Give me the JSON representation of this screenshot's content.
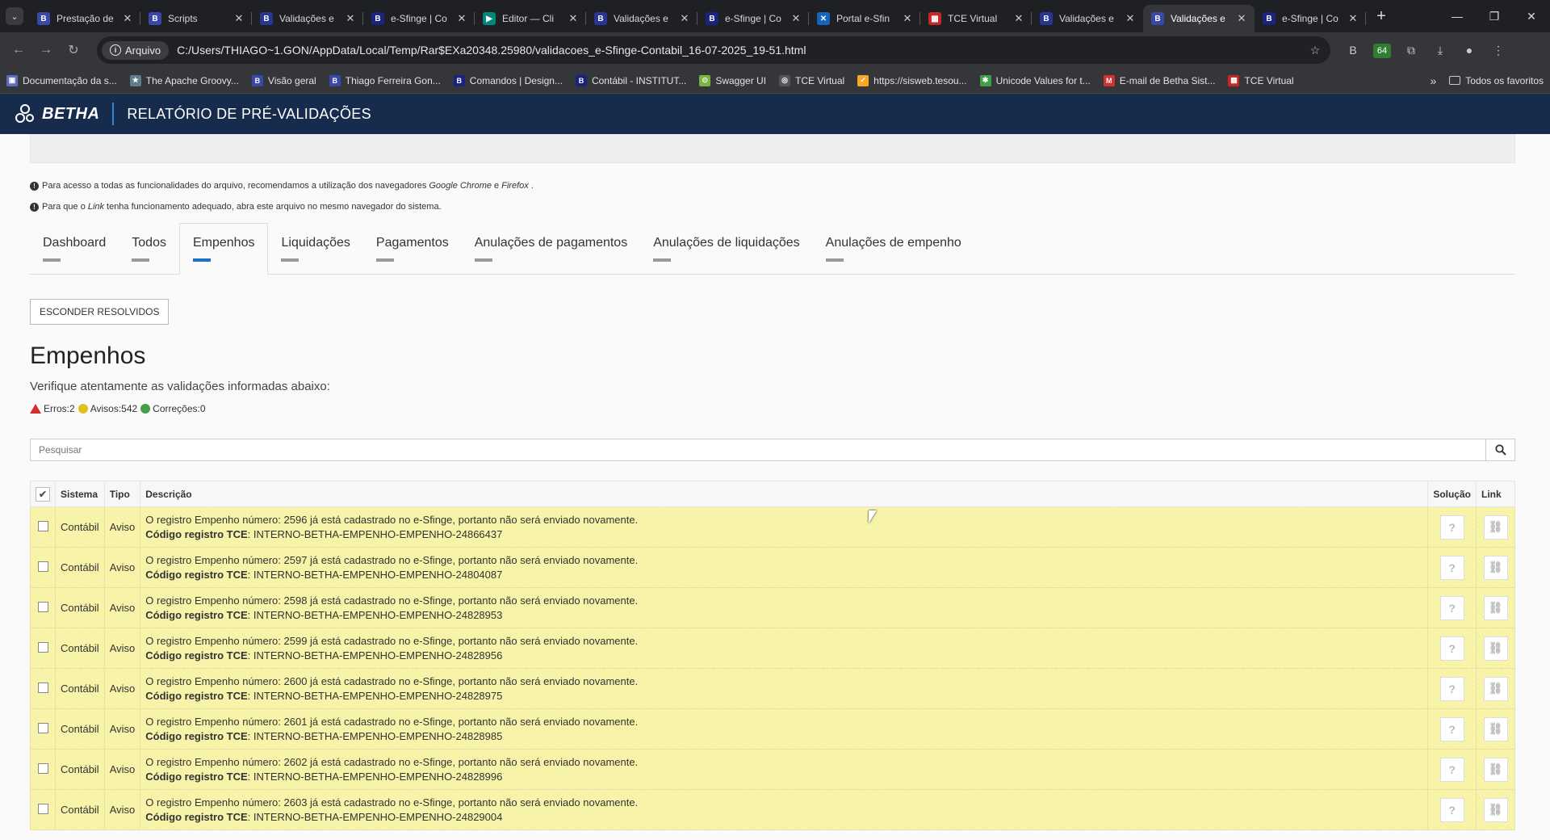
{
  "browser": {
    "tabs": [
      {
        "title": "Prestação de",
        "fav": "B",
        "color": "#3949ab"
      },
      {
        "title": "Scripts",
        "fav": "B",
        "color": "#3949ab"
      },
      {
        "title": "Validações e",
        "fav": "B",
        "color": "#283593"
      },
      {
        "title": "e-Sfinge | Co",
        "fav": "B",
        "color": "#1a237e"
      },
      {
        "title": "Editor — Cli",
        "fav": "▶",
        "color": "#00897b"
      },
      {
        "title": "Validações e",
        "fav": "B",
        "color": "#283593"
      },
      {
        "title": "e-Sfinge | Co",
        "fav": "B",
        "color": "#1a237e"
      },
      {
        "title": "Portal e-Sfin",
        "fav": "✕",
        "color": "#1565c0"
      },
      {
        "title": "TCE Virtual",
        "fav": "▦",
        "color": "#c62828"
      },
      {
        "title": "Validações e",
        "fav": "B",
        "color": "#283593"
      },
      {
        "title": "Validações e",
        "fav": "B",
        "color": "#3949ab"
      },
      {
        "title": "e-Sfinge | Co",
        "fav": "B",
        "color": "#1a237e"
      }
    ],
    "active_tab_index": 10,
    "address_chip": "Arquivo",
    "url": "C:/Users/THIAGO~1.GON/AppData/Local/Temp/Rar$EXa20348.25980/validacoes_e-Sfinge-Contabil_16-07-2025_19-51.html",
    "extension_badge": "64",
    "bookmarks": [
      {
        "label": "Documentação da s...",
        "color": "#5c6bc0",
        "icon": "▣"
      },
      {
        "label": "The Apache Groovy...",
        "color": "#607d8b",
        "icon": "★"
      },
      {
        "label": "Visão geral",
        "color": "#3949ab",
        "icon": "B"
      },
      {
        "label": "Thiago Ferreira Gon...",
        "color": "#3949ab",
        "icon": "B"
      },
      {
        "label": "Comandos | Design...",
        "color": "#1a237e",
        "icon": "B"
      },
      {
        "label": "Contábil - INSTITUT...",
        "color": "#1a237e",
        "icon": "B"
      },
      {
        "label": "Swagger UI",
        "color": "#7cb342",
        "icon": "⊙"
      },
      {
        "label": "TCE Virtual",
        "color": "#555",
        "icon": "◎"
      },
      {
        "label": "https://sisweb.tesou...",
        "color": "#f9a825",
        "icon": "✓"
      },
      {
        "label": "Unicode Values for t...",
        "color": "#43a047",
        "icon": "✱"
      },
      {
        "label": "E-mail de Betha Sist...",
        "color": "#d32f2f",
        "icon": "M"
      },
      {
        "label": "TCE Virtual",
        "color": "#c62828",
        "icon": "▦"
      }
    ],
    "bookmarks_folder": "Todos os favoritos"
  },
  "app": {
    "brand": "BETHA",
    "title": "RELATÓRIO DE PRÉ-VALIDAÇÕES"
  },
  "notes": {
    "note1_pre": "Para acesso a todas as funcionalidades do arquivo, recomendamos a utilização dos navegadores",
    "note1_chrome": "Google Chrome",
    "note1_and": "e",
    "note1_firefox": "Firefox",
    "note1_end": ".",
    "note2_pre": "Para que o",
    "note2_link": "Link",
    "note2_post": "tenha funcionamento adequado, abra este arquivo no mesmo navegador do sistema."
  },
  "nav_tabs": [
    "Dashboard",
    "Todos",
    "Empenhos",
    "Liquidações",
    "Pagamentos",
    "Anulações de pagamentos",
    "Anulações de liquidações",
    "Anulações de empenho"
  ],
  "active_nav_tab": 2,
  "hide_button": "ESCONDER RESOLVIDOS",
  "section": {
    "title": "Empenhos",
    "subtitle": "Verifique atentamente as validações informadas abaixo:",
    "errors": "Erros:2",
    "warnings": "Avisos:542",
    "corrections": "Correções:0"
  },
  "colors": {
    "error": "#d32f2f",
    "warning": "#e0c21a",
    "correction": "#43a047",
    "header": "#172b4d",
    "active_tab": "#1a73c8",
    "row_bg": "#f7f2a0"
  },
  "search": {
    "placeholder": "Pesquisar"
  },
  "table": {
    "headers": {
      "check": "✔",
      "sistema": "Sistema",
      "tipo": "Tipo",
      "descricao": "Descrição",
      "solucao": "Solução",
      "link": "Link"
    },
    "code_label": "Código registro TCE",
    "rows": [
      {
        "sistema": "Contábil",
        "tipo": "Aviso",
        "msg": "O registro Empenho número: 2596 já está cadastrado no e-Sfinge, portanto não será enviado novamente.",
        "code": "INTERNO-BETHA-EMPENHO-EMPENHO-24866437"
      },
      {
        "sistema": "Contábil",
        "tipo": "Aviso",
        "msg": "O registro Empenho número: 2597 já está cadastrado no e-Sfinge, portanto não será enviado novamente.",
        "code": "INTERNO-BETHA-EMPENHO-EMPENHO-24804087"
      },
      {
        "sistema": "Contábil",
        "tipo": "Aviso",
        "msg": "O registro Empenho número: 2598 já está cadastrado no e-Sfinge, portanto não será enviado novamente.",
        "code": "INTERNO-BETHA-EMPENHO-EMPENHO-24828953"
      },
      {
        "sistema": "Contábil",
        "tipo": "Aviso",
        "msg": "O registro Empenho número: 2599 já está cadastrado no e-Sfinge, portanto não será enviado novamente.",
        "code": "INTERNO-BETHA-EMPENHO-EMPENHO-24828956"
      },
      {
        "sistema": "Contábil",
        "tipo": "Aviso",
        "msg": "O registro Empenho número: 2600 já está cadastrado no e-Sfinge, portanto não será enviado novamente.",
        "code": "INTERNO-BETHA-EMPENHO-EMPENHO-24828975"
      },
      {
        "sistema": "Contábil",
        "tipo": "Aviso",
        "msg": "O registro Empenho número: 2601 já está cadastrado no e-Sfinge, portanto não será enviado novamente.",
        "code": "INTERNO-BETHA-EMPENHO-EMPENHO-24828985"
      },
      {
        "sistema": "Contábil",
        "tipo": "Aviso",
        "msg": "O registro Empenho número: 2602 já está cadastrado no e-Sfinge, portanto não será enviado novamente.",
        "code": "INTERNO-BETHA-EMPENHO-EMPENHO-24828996"
      },
      {
        "sistema": "Contábil",
        "tipo": "Aviso",
        "msg": "O registro Empenho número: 2603 já está cadastrado no e-Sfinge, portanto não será enviado novamente.",
        "code": "INTERNO-BETHA-EMPENHO-EMPENHO-24829004"
      }
    ]
  }
}
